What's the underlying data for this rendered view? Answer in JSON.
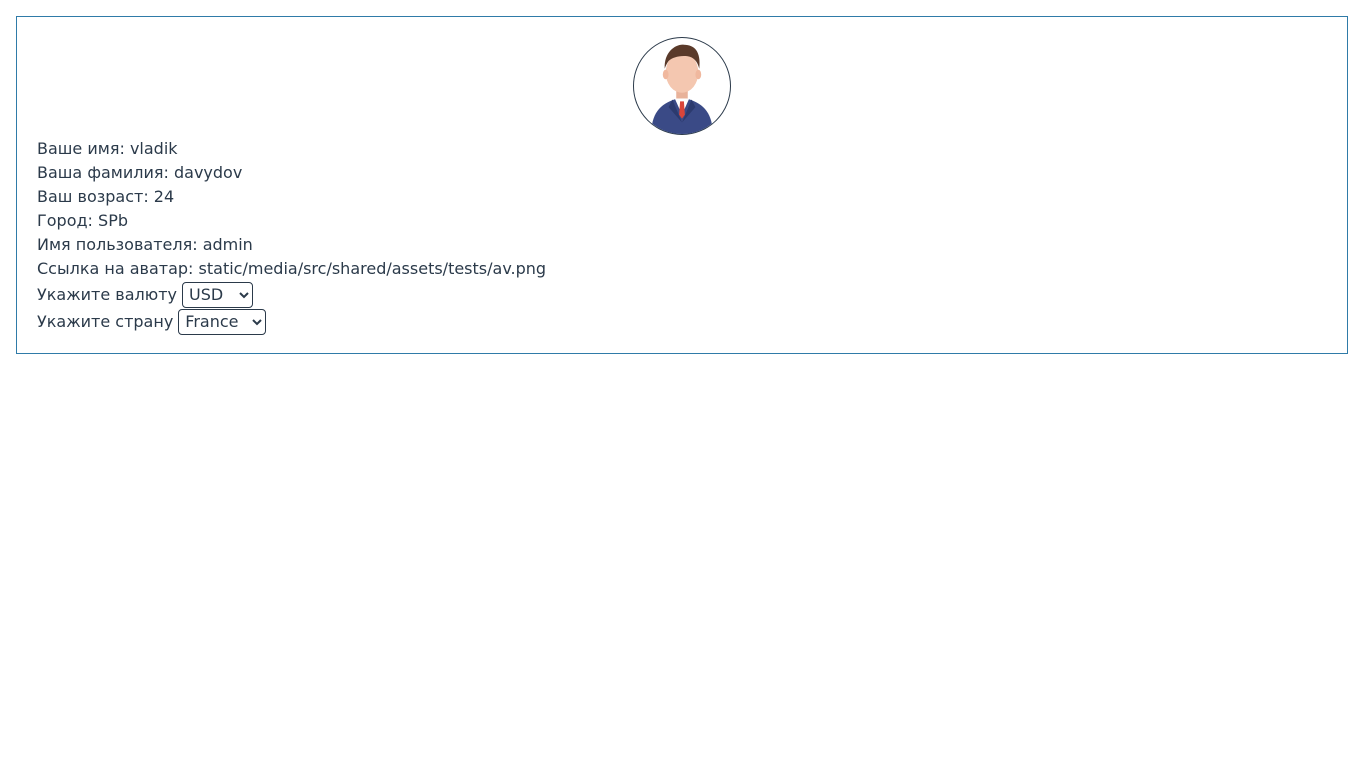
{
  "profile": {
    "avatar_alt": "avatar",
    "first_name_label": "Ваше имя:",
    "first_name_value": "vladik",
    "last_name_label": "Ваша фамилия:",
    "last_name_value": "davydov",
    "age_label": "Ваш возраст:",
    "age_value": "24",
    "city_label": "Город:",
    "city_value": "SPb",
    "username_label": "Имя пользователя:",
    "username_value": "admin",
    "avatar_link_label": "Ссылка на аватар:",
    "avatar_link_value": "static/media/src/shared/assets/tests/av.png",
    "currency_label": "Укажите валюту",
    "currency_selected": "USD",
    "country_label": "Укажите страну",
    "country_selected": "France"
  },
  "icons": {
    "avatar": "person-avatar-icon",
    "dropdown": "chevron-down-icon"
  },
  "colors": {
    "card_border": "#2f7ba8",
    "text": "#2b3a4a",
    "suit": "#3a4a86",
    "hair": "#5a3a2a",
    "skin": "#f4c7b0",
    "tie": "#d9453a"
  }
}
